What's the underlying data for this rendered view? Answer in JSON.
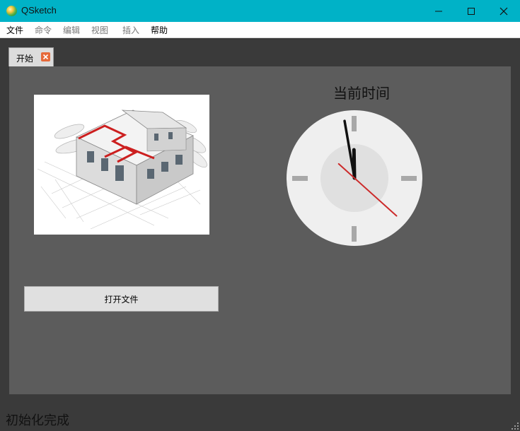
{
  "window": {
    "title": "QSketch",
    "app_icon": "qsketch-app-icon",
    "controls": [
      "minimize-icon",
      "maximize-icon",
      "close-icon"
    ]
  },
  "menu": {
    "items": [
      {
        "label": "文件",
        "enabled": true
      },
      {
        "label": "命令",
        "enabled": false
      },
      {
        "label": "编辑",
        "enabled": false
      },
      {
        "label": "视图",
        "enabled": false
      },
      {
        "label": "插入",
        "enabled": false
      },
      {
        "label": "帮助",
        "enabled": true
      }
    ]
  },
  "tabs": [
    {
      "label": "开始",
      "active": true,
      "close_icon": "close-icon"
    }
  ],
  "start_page": {
    "image": "house-architecture-illustration",
    "open_file_label": "打开文件"
  },
  "clock": {
    "title": "当前时间",
    "hour": 11,
    "minute": 58,
    "second": 22
  },
  "status": {
    "text": "初始化完成"
  },
  "colors": {
    "titlebar": "#00b2c7",
    "panel": "#5c5c5c",
    "background": "#3a3a3a",
    "second_hand": "#cc2a2a"
  }
}
